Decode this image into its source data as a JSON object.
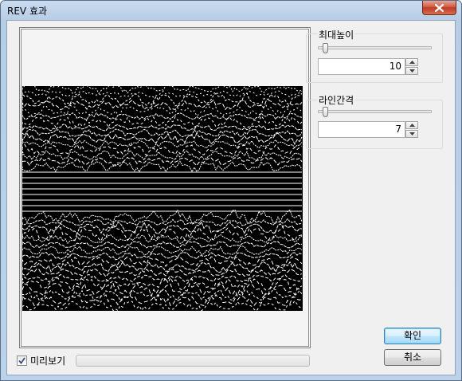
{
  "window": {
    "title": "REV 효과"
  },
  "preview": {
    "checkbox_label": "미리보기",
    "checked": true
  },
  "max_height": {
    "label": "최대높이",
    "value": "10"
  },
  "line_spacing": {
    "label": "라인간격",
    "value": "7"
  },
  "buttons": {
    "ok": "확인",
    "cancel": "취소"
  },
  "icons": {
    "close": "close-icon",
    "check": "checkmark-icon",
    "up": "spin-up-arrow-icon",
    "down": "spin-down-arrow-icon"
  }
}
